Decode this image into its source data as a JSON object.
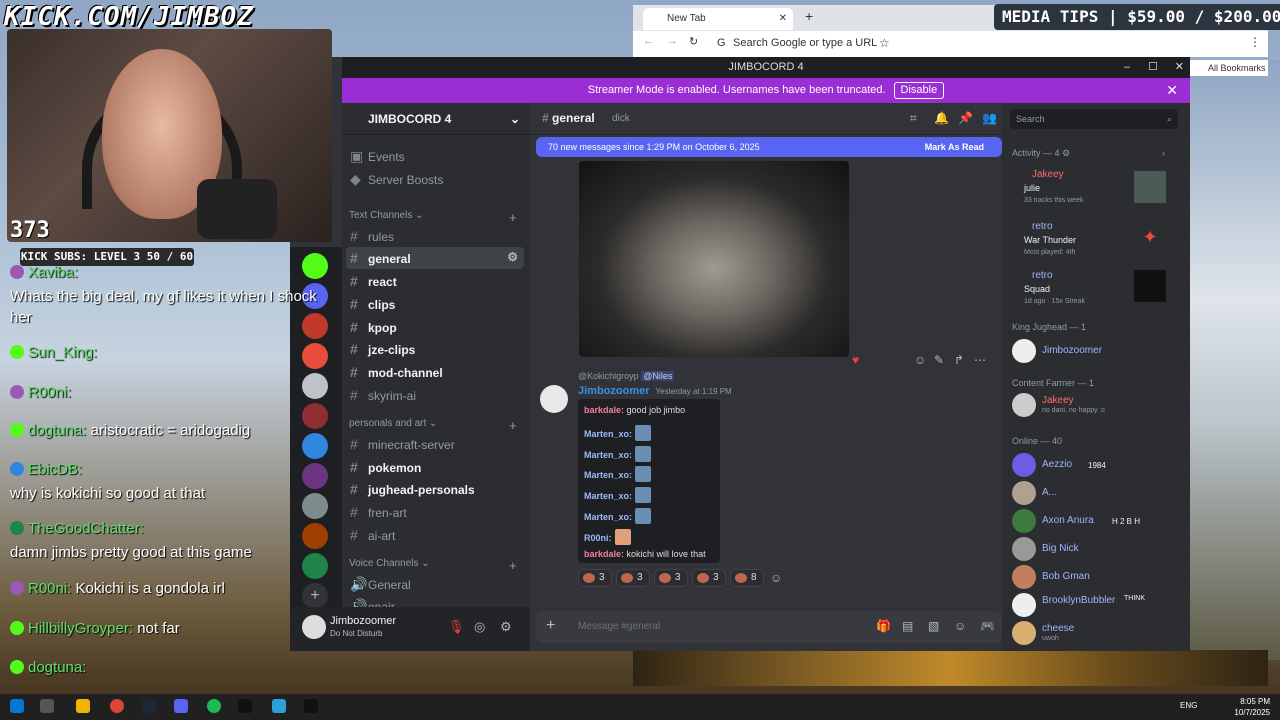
{
  "overlay": {
    "title": "KICK.COM/JIMBOZ",
    "viewers": "373",
    "kick_subs": "KICK SUBS: LEVEL 3 50 / 60",
    "media_tips": "MEDIA TIPS | $59.00 / $200.00"
  },
  "stream_chat": [
    {
      "user": "Xaviba:",
      "text": "Whats the big deal, my gf likes it when I shock"
    },
    {
      "user": "",
      "text": "her"
    },
    {
      "user": "Sun_King:",
      "text": ""
    },
    {
      "user": "R00ni:",
      "text": ""
    },
    {
      "user": "dogtuna:",
      "text": "aristocratic = aridogadig"
    },
    {
      "user": "EbicDB:",
      "text": ""
    },
    {
      "user": "",
      "text": "why is kokichi so good at that"
    },
    {
      "user": "TheGoodChatter:",
      "text": ""
    },
    {
      "user": "",
      "text": "damn jimbs pretty good at this game"
    },
    {
      "user": "R00ni:",
      "text": "Kokichi is a gondola irl"
    },
    {
      "user": "HillbillyGroyper:",
      "text": "not far"
    },
    {
      "user": "dogtuna:",
      "text": ""
    }
  ],
  "chrome": {
    "tab_label": "New Tab",
    "omnibox_placeholder": "Search Google or type a URL",
    "bookmarks": "All Bookmarks"
  },
  "discord": {
    "window_title": "JIMBOCORD 4",
    "banner_text": "Streamer Mode is enabled. Usernames have been truncated.",
    "banner_button": "Disable",
    "server_name": "JIMBOCORD 4",
    "events": "Events",
    "boosts": "Server Boosts",
    "categories": [
      "Text Channels",
      "personals and art",
      "Voice Channels"
    ],
    "text_channels": [
      "rules",
      "general",
      "react",
      "clips",
      "kpop",
      "jze-clips",
      "mod-channel",
      "skyrim-ai"
    ],
    "personal_channels": [
      "minecraft-server",
      "pokemon",
      "jughead-personals",
      "fren-art",
      "ai-art"
    ],
    "voice_channels": [
      "General",
      "onair"
    ],
    "user": {
      "name": "Jimbozoomer",
      "status": "Do Not Disturb"
    },
    "channel": {
      "name": "general",
      "topic": "dick"
    },
    "new_messages": "70 new messages since 1:29 PM on October 6, 2025",
    "mark_as_read": "Mark As Read",
    "message": {
      "reply_user": "@Kokichigroyp",
      "reply_mention": "@Niles",
      "author": "Jimbozoomer",
      "time": "Yesterday at 1:19 PM",
      "embed_lines": [
        {
          "name": "barkdale:",
          "text": "good job jimbo"
        },
        {
          "name": "Marten_xo:",
          "text": ""
        },
        {
          "name": "Marten_xo:",
          "text": ""
        },
        {
          "name": "Marten_xo:",
          "text": ""
        },
        {
          "name": "Marten_xo:",
          "text": ""
        },
        {
          "name": "Marten_xo:",
          "text": ""
        },
        {
          "name": "R00ni:",
          "text": ""
        },
        {
          "name": "barkdale:",
          "text": "kokichi will love that"
        }
      ],
      "reactions": [
        "3",
        "3",
        "3",
        "3",
        "8"
      ]
    },
    "composer_placeholder": "Message #general",
    "search_placeholder": "Search",
    "activity_header": "Activity — 4",
    "activities": [
      {
        "name": "Jakeey",
        "title": "julie",
        "sub": "33 tracks this week"
      },
      {
        "name": "retro",
        "title": "War Thunder",
        "sub": "Most played: 4th"
      },
      {
        "name": "retro",
        "title": "Squad",
        "sub": "1d ago · 15x Streak"
      }
    ],
    "member_groups": [
      {
        "header": "King Jughead — 1",
        "members": [
          {
            "name": "Jimbozoomer",
            "sub": ""
          }
        ]
      },
      {
        "header": "Content Farmer — 1",
        "members": [
          {
            "name": "Jakeey",
            "sub": "no dani, no happy :c"
          }
        ]
      },
      {
        "header": "Online — 40",
        "members": [
          {
            "name": "Aezzio",
            "sub": "1984"
          },
          {
            "name": "A...",
            "sub": ""
          },
          {
            "name": "Axon Anura",
            "sub": "H 2 B H"
          },
          {
            "name": "Big Nick",
            "sub": ""
          },
          {
            "name": "Bob Gman",
            "sub": ""
          },
          {
            "name": "BrooklynBubbler",
            "sub": "THINK"
          },
          {
            "name": "cheese",
            "sub": "uwoh"
          }
        ]
      }
    ]
  },
  "taskbar": {
    "lang": "ENG",
    "time": "8:05 PM",
    "date": "10/7/2025"
  }
}
